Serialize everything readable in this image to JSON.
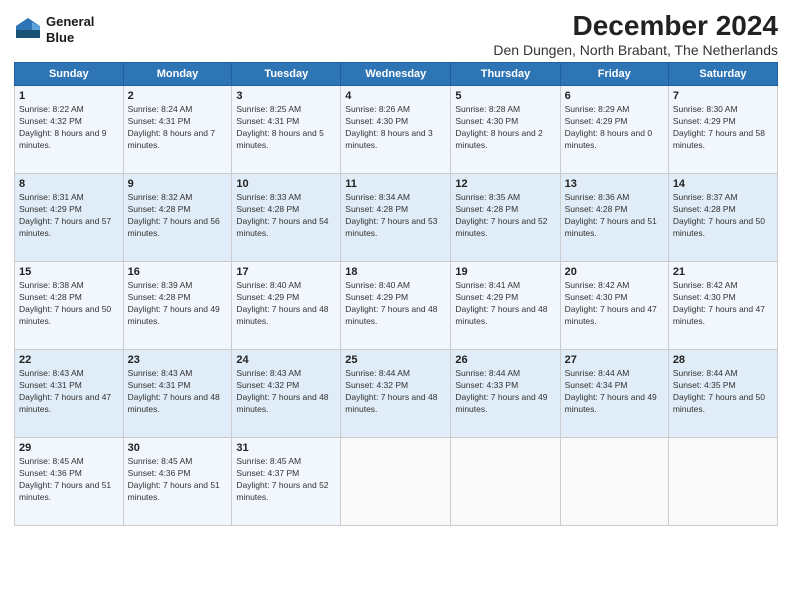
{
  "logo": {
    "line1": "General",
    "line2": "Blue"
  },
  "title": "December 2024",
  "subtitle": "Den Dungen, North Brabant, The Netherlands",
  "weekdays": [
    "Sunday",
    "Monday",
    "Tuesday",
    "Wednesday",
    "Thursday",
    "Friday",
    "Saturday"
  ],
  "weeks": [
    [
      {
        "day": "1",
        "sunrise": "8:22 AM",
        "sunset": "4:32 PM",
        "daylight": "8 hours and 9 minutes."
      },
      {
        "day": "2",
        "sunrise": "8:24 AM",
        "sunset": "4:31 PM",
        "daylight": "8 hours and 7 minutes."
      },
      {
        "day": "3",
        "sunrise": "8:25 AM",
        "sunset": "4:31 PM",
        "daylight": "8 hours and 5 minutes."
      },
      {
        "day": "4",
        "sunrise": "8:26 AM",
        "sunset": "4:30 PM",
        "daylight": "8 hours and 3 minutes."
      },
      {
        "day": "5",
        "sunrise": "8:28 AM",
        "sunset": "4:30 PM",
        "daylight": "8 hours and 2 minutes."
      },
      {
        "day": "6",
        "sunrise": "8:29 AM",
        "sunset": "4:29 PM",
        "daylight": "8 hours and 0 minutes."
      },
      {
        "day": "7",
        "sunrise": "8:30 AM",
        "sunset": "4:29 PM",
        "daylight": "7 hours and 58 minutes."
      }
    ],
    [
      {
        "day": "8",
        "sunrise": "8:31 AM",
        "sunset": "4:29 PM",
        "daylight": "7 hours and 57 minutes."
      },
      {
        "day": "9",
        "sunrise": "8:32 AM",
        "sunset": "4:28 PM",
        "daylight": "7 hours and 56 minutes."
      },
      {
        "day": "10",
        "sunrise": "8:33 AM",
        "sunset": "4:28 PM",
        "daylight": "7 hours and 54 minutes."
      },
      {
        "day": "11",
        "sunrise": "8:34 AM",
        "sunset": "4:28 PM",
        "daylight": "7 hours and 53 minutes."
      },
      {
        "day": "12",
        "sunrise": "8:35 AM",
        "sunset": "4:28 PM",
        "daylight": "7 hours and 52 minutes."
      },
      {
        "day": "13",
        "sunrise": "8:36 AM",
        "sunset": "4:28 PM",
        "daylight": "7 hours and 51 minutes."
      },
      {
        "day": "14",
        "sunrise": "8:37 AM",
        "sunset": "4:28 PM",
        "daylight": "7 hours and 50 minutes."
      }
    ],
    [
      {
        "day": "15",
        "sunrise": "8:38 AM",
        "sunset": "4:28 PM",
        "daylight": "7 hours and 50 minutes."
      },
      {
        "day": "16",
        "sunrise": "8:39 AM",
        "sunset": "4:28 PM",
        "daylight": "7 hours and 49 minutes."
      },
      {
        "day": "17",
        "sunrise": "8:40 AM",
        "sunset": "4:29 PM",
        "daylight": "7 hours and 48 minutes."
      },
      {
        "day": "18",
        "sunrise": "8:40 AM",
        "sunset": "4:29 PM",
        "daylight": "7 hours and 48 minutes."
      },
      {
        "day": "19",
        "sunrise": "8:41 AM",
        "sunset": "4:29 PM",
        "daylight": "7 hours and 48 minutes."
      },
      {
        "day": "20",
        "sunrise": "8:42 AM",
        "sunset": "4:30 PM",
        "daylight": "7 hours and 47 minutes."
      },
      {
        "day": "21",
        "sunrise": "8:42 AM",
        "sunset": "4:30 PM",
        "daylight": "7 hours and 47 minutes."
      }
    ],
    [
      {
        "day": "22",
        "sunrise": "8:43 AM",
        "sunset": "4:31 PM",
        "daylight": "7 hours and 47 minutes."
      },
      {
        "day": "23",
        "sunrise": "8:43 AM",
        "sunset": "4:31 PM",
        "daylight": "7 hours and 48 minutes."
      },
      {
        "day": "24",
        "sunrise": "8:43 AM",
        "sunset": "4:32 PM",
        "daylight": "7 hours and 48 minutes."
      },
      {
        "day": "25",
        "sunrise": "8:44 AM",
        "sunset": "4:32 PM",
        "daylight": "7 hours and 48 minutes."
      },
      {
        "day": "26",
        "sunrise": "8:44 AM",
        "sunset": "4:33 PM",
        "daylight": "7 hours and 49 minutes."
      },
      {
        "day": "27",
        "sunrise": "8:44 AM",
        "sunset": "4:34 PM",
        "daylight": "7 hours and 49 minutes."
      },
      {
        "day": "28",
        "sunrise": "8:44 AM",
        "sunset": "4:35 PM",
        "daylight": "7 hours and 50 minutes."
      }
    ],
    [
      {
        "day": "29",
        "sunrise": "8:45 AM",
        "sunset": "4:36 PM",
        "daylight": "7 hours and 51 minutes."
      },
      {
        "day": "30",
        "sunrise": "8:45 AM",
        "sunset": "4:36 PM",
        "daylight": "7 hours and 51 minutes."
      },
      {
        "day": "31",
        "sunrise": "8:45 AM",
        "sunset": "4:37 PM",
        "daylight": "7 hours and 52 minutes."
      },
      null,
      null,
      null,
      null
    ]
  ]
}
